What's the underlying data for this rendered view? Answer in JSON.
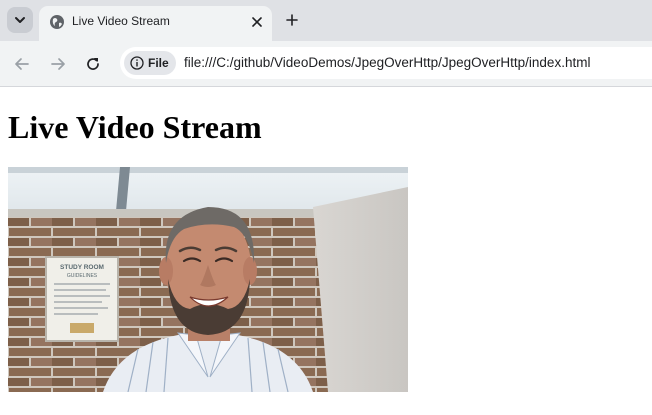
{
  "browser": {
    "tab": {
      "title": "Live Video Stream"
    },
    "address_bar": {
      "security_chip": "File",
      "url": "file:///C:/github/VideoDemos/JpegOverHttp/JpegOverHttp/index.html"
    },
    "icons": {
      "tab_search": "chevron-down-icon",
      "favicon": "globe-icon",
      "tab_close": "close-icon",
      "new_tab": "plus-icon",
      "back": "arrow-left-icon",
      "forward": "arrow-right-icon",
      "reload": "reload-icon",
      "site_info": "info-icon"
    }
  },
  "page": {
    "heading": "Live Video Stream",
    "video": {
      "subject": "webcam frame: smiling bearded man in striped shirt in front of a brick wall",
      "sign_title": "STUDY ROOM",
      "sign_subtitle": "GUIDELINES"
    }
  },
  "colors": {
    "tabstrip": "#dfe1e5",
    "toolbar": "#f1f3f4",
    "brick": "#8a6a52",
    "mortar": "#cfc7bd"
  }
}
